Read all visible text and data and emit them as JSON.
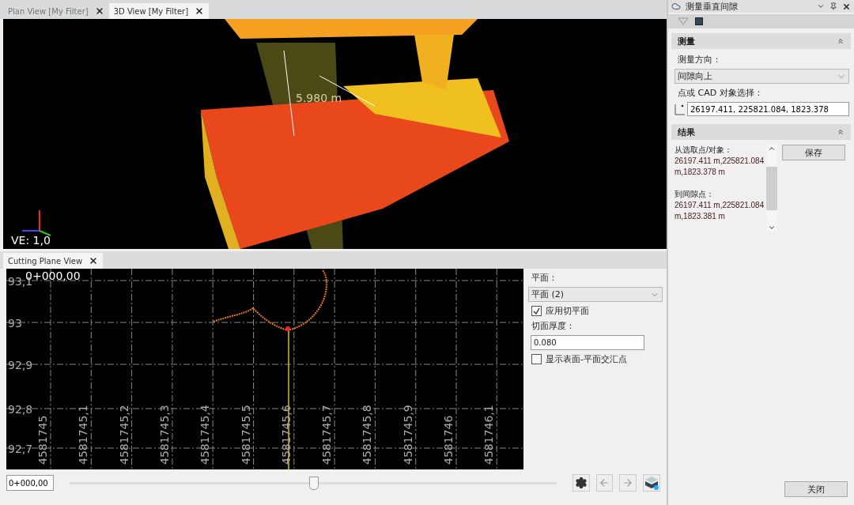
{
  "view_tabs": [
    {
      "label": "Plan View [My Filter]",
      "selected": false
    },
    {
      "label": "3D View [My Filter]",
      "selected": true
    }
  ],
  "view_3d": {
    "measurement": "5.980 m",
    "ve_label": "VE: 1,0"
  },
  "cutting_tabs": [
    {
      "label": "Cutting Plane View",
      "selected": true
    }
  ],
  "profile": {
    "station": "0+000,00",
    "y_labels": [
      "93,1",
      "93",
      "92,9",
      "92,8",
      "92,7"
    ],
    "x_labels": [
      "4581745",
      "4581745,1",
      "4581745,2",
      "4581745,3",
      "4581745,4",
      "4581745,5",
      "4581745,6",
      "4581745,7",
      "4581745,8",
      "4581745,9",
      "4581746",
      "4581746,1"
    ]
  },
  "plane_controls": {
    "plane_label": "平面：",
    "plane_value": "平面 (2)",
    "apply": {
      "label": "应用切平面",
      "checked": true
    },
    "thickness_label": "切面厚度：",
    "thickness_value": "0.080",
    "show_points": {
      "label": "显示表面-平面交汇点",
      "checked": false
    }
  },
  "bottom_bar": {
    "station_value": "0+000,00",
    "slider": {
      "level": 0.5
    }
  },
  "panel": {
    "title": "测量垂直间隙",
    "measure_section": {
      "title": "测量",
      "expanded": true,
      "direction_label": "测量方向：",
      "direction_value": "间隙向上",
      "pick_label": "点或 CAD 对象选择：",
      "pick_value": "26197.411, 225821.084, 1823.378"
    },
    "result_section": {
      "title": "结果",
      "expanded": true,
      "results": [
        {
          "label": "从选取点/对象：",
          "value": "26197.411 m,225821.084 m,1823.378 m"
        },
        {
          "label": "到间隙点：",
          "value": "26197.411 m,225821.084 m,1823.381 m"
        }
      ],
      "save_button": "保存"
    },
    "close_button": "关闭"
  }
}
